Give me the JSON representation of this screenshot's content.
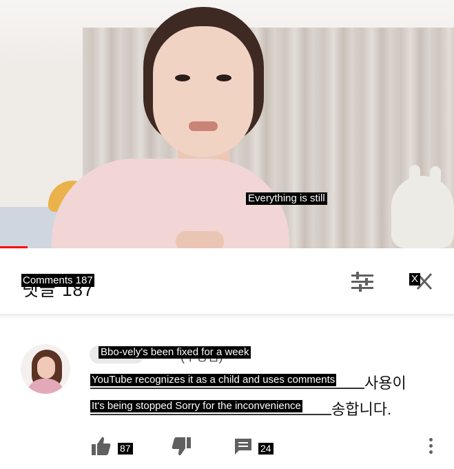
{
  "video": {
    "caption": "Everything is still",
    "progress_fraction": 0.06,
    "accent_color": "#ff0000"
  },
  "comments_header": {
    "title": "Comments 187",
    "ghost_text": "댓글 187",
    "close_label": "X",
    "icons": [
      "sort-icon",
      "close-icon"
    ]
  },
  "comment": {
    "author": "Bbo-vely's been fixed for a week",
    "author_ghost": "(수정됨)",
    "lines": [
      "YouTube recognizes it as a child and uses comments",
      "It's being stopped Sorry for the inconvenience"
    ],
    "ghost_tails": [
      "사용이",
      "송합니다."
    ],
    "likes": "87",
    "replies": "24",
    "icons": [
      "thumbs-up-icon",
      "thumbs-down-icon",
      "reply-icon",
      "more-vertical-icon"
    ]
  }
}
